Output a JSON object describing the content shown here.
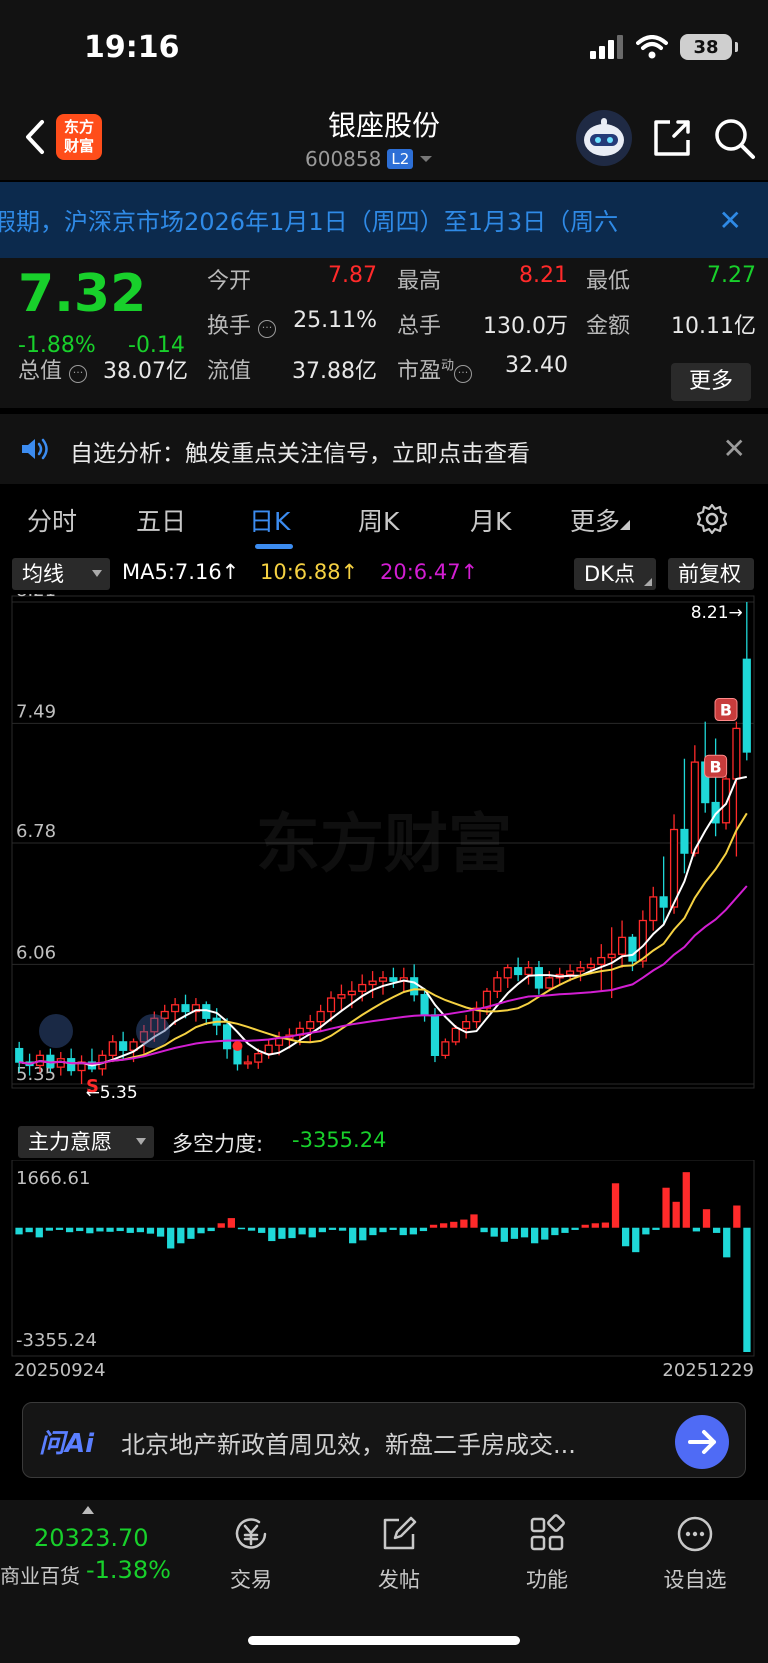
{
  "status": {
    "time": "19:16",
    "battery": "38"
  },
  "header": {
    "logo_text": "东方财富",
    "stock_name": "银座股份",
    "stock_code": "600858",
    "level_badge": "L2"
  },
  "notice": {
    "text": "假期，沪深京市场2026年1月1日（周四）至1月3日（周六"
  },
  "quote": {
    "price": "7.32",
    "change_pct": "-1.88%",
    "change_abs": "-0.14",
    "open_label": "今开",
    "open": "7.87",
    "high_label": "最高",
    "high": "8.21",
    "low_label": "最低",
    "low": "7.27",
    "turnover_label": "换手",
    "turnover": "25.11%",
    "volume_label": "总手",
    "volume": "130.0万",
    "amount_label": "金额",
    "amount": "10.11亿",
    "mktcap_label": "总值",
    "mktcap": "38.07亿",
    "float_label": "流值",
    "float_cap": "37.88亿",
    "pe_label": "市盈",
    "pe_sup": "动",
    "pe": "32.40",
    "more_label": "更多"
  },
  "alert": {
    "text": "自选分析：触发重点关注信号，立即点击查看"
  },
  "tabs": [
    "分时",
    "五日",
    "日K",
    "周K",
    "月K",
    "更多"
  ],
  "ma_bar": {
    "selector": "均线",
    "ma5": "MA5:7.16↑",
    "ma10": "10:6.88↑",
    "ma20": "20:6.47↑",
    "dk_label": "DK点",
    "adjust_label": "前复权",
    "colors": {
      "ma5": "#ffffff",
      "ma10": "#f5d142",
      "ma20": "#d21ed2",
      "up": "#ff2a2a",
      "down": "#1fd8d8"
    }
  },
  "watermark": "东方财富",
  "chart_data": [
    {
      "type": "candlestick",
      "y_ticks": [
        "8.21",
        "7.49",
        "6.78",
        "6.06",
        "5.35"
      ],
      "ylim": [
        5.35,
        8.21
      ],
      "max_label": "8.21→",
      "min_label": "←5.35",
      "signal_labels": [
        "S",
        "B",
        "B"
      ],
      "candles": [
        {
          "o": 5.56,
          "h": 5.6,
          "l": 5.42,
          "c": 5.48
        },
        {
          "o": 5.48,
          "h": 5.53,
          "l": 5.4,
          "c": 5.46
        },
        {
          "o": 5.46,
          "h": 5.55,
          "l": 5.42,
          "c": 5.52
        },
        {
          "o": 5.52,
          "h": 5.56,
          "l": 5.42,
          "c": 5.45
        },
        {
          "o": 5.45,
          "h": 5.54,
          "l": 5.4,
          "c": 5.5
        },
        {
          "o": 5.5,
          "h": 5.56,
          "l": 5.4,
          "c": 5.43
        },
        {
          "o": 5.43,
          "h": 5.52,
          "l": 5.35,
          "c": 5.48
        },
        {
          "o": 5.48,
          "h": 5.56,
          "l": 5.42,
          "c": 5.44
        },
        {
          "o": 5.44,
          "h": 5.55,
          "l": 5.4,
          "c": 5.52
        },
        {
          "o": 5.52,
          "h": 5.64,
          "l": 5.48,
          "c": 5.6
        },
        {
          "o": 5.6,
          "h": 5.66,
          "l": 5.5,
          "c": 5.55
        },
        {
          "o": 5.55,
          "h": 5.62,
          "l": 5.48,
          "c": 5.6
        },
        {
          "o": 5.6,
          "h": 5.7,
          "l": 5.52,
          "c": 5.66
        },
        {
          "o": 5.66,
          "h": 5.78,
          "l": 5.6,
          "c": 5.74
        },
        {
          "o": 5.74,
          "h": 5.82,
          "l": 5.66,
          "c": 5.78
        },
        {
          "o": 5.78,
          "h": 5.86,
          "l": 5.7,
          "c": 5.82
        },
        {
          "o": 5.82,
          "h": 5.88,
          "l": 5.74,
          "c": 5.78
        },
        {
          "o": 5.78,
          "h": 5.86,
          "l": 5.72,
          "c": 5.82
        },
        {
          "o": 5.82,
          "h": 5.84,
          "l": 5.7,
          "c": 5.74
        },
        {
          "o": 5.74,
          "h": 5.8,
          "l": 5.64,
          "c": 5.7
        },
        {
          "o": 5.7,
          "h": 5.74,
          "l": 5.5,
          "c": 5.56
        },
        {
          "o": 5.56,
          "h": 5.6,
          "l": 5.43,
          "c": 5.47
        },
        {
          "o": 5.47,
          "h": 5.52,
          "l": 5.44,
          "c": 5.48
        },
        {
          "o": 5.48,
          "h": 5.56,
          "l": 5.44,
          "c": 5.53
        },
        {
          "o": 5.53,
          "h": 5.62,
          "l": 5.5,
          "c": 5.58
        },
        {
          "o": 5.58,
          "h": 5.66,
          "l": 5.52,
          "c": 5.62
        },
        {
          "o": 5.62,
          "h": 5.68,
          "l": 5.56,
          "c": 5.64
        },
        {
          "o": 5.64,
          "h": 5.72,
          "l": 5.58,
          "c": 5.68
        },
        {
          "o": 5.68,
          "h": 5.76,
          "l": 5.6,
          "c": 5.72
        },
        {
          "o": 5.72,
          "h": 5.82,
          "l": 5.66,
          "c": 5.78
        },
        {
          "o": 5.78,
          "h": 5.9,
          "l": 5.72,
          "c": 5.86
        },
        {
          "o": 5.86,
          "h": 5.94,
          "l": 5.78,
          "c": 5.88
        },
        {
          "o": 5.88,
          "h": 5.96,
          "l": 5.8,
          "c": 5.9
        },
        {
          "o": 5.9,
          "h": 6.0,
          "l": 5.84,
          "c": 5.94
        },
        {
          "o": 5.94,
          "h": 6.02,
          "l": 5.86,
          "c": 5.96
        },
        {
          "o": 5.96,
          "h": 6.02,
          "l": 5.88,
          "c": 5.98
        },
        {
          "o": 5.98,
          "h": 6.04,
          "l": 5.92,
          "c": 5.96
        },
        {
          "o": 5.96,
          "h": 6.04,
          "l": 5.9,
          "c": 5.98
        },
        {
          "o": 5.98,
          "h": 6.06,
          "l": 5.84,
          "c": 5.88
        },
        {
          "o": 5.88,
          "h": 5.92,
          "l": 5.72,
          "c": 5.76
        },
        {
          "o": 5.76,
          "h": 5.8,
          "l": 5.48,
          "c": 5.52
        },
        {
          "o": 5.52,
          "h": 5.62,
          "l": 5.5,
          "c": 5.6
        },
        {
          "o": 5.6,
          "h": 5.7,
          "l": 5.58,
          "c": 5.68
        },
        {
          "o": 5.68,
          "h": 5.76,
          "l": 5.62,
          "c": 5.72
        },
        {
          "o": 5.72,
          "h": 5.84,
          "l": 5.68,
          "c": 5.8
        },
        {
          "o": 5.8,
          "h": 5.92,
          "l": 5.76,
          "c": 5.9
        },
        {
          "o": 5.9,
          "h": 6.02,
          "l": 5.86,
          "c": 5.98
        },
        {
          "o": 5.98,
          "h": 6.06,
          "l": 5.92,
          "c": 6.04
        },
        {
          "o": 6.04,
          "h": 6.1,
          "l": 5.96,
          "c": 6.0
        },
        {
          "o": 6.0,
          "h": 6.08,
          "l": 5.94,
          "c": 6.04
        },
        {
          "o": 6.04,
          "h": 6.08,
          "l": 5.88,
          "c": 5.92
        },
        {
          "o": 5.92,
          "h": 6.02,
          "l": 5.9,
          "c": 5.98
        },
        {
          "o": 5.98,
          "h": 6.04,
          "l": 5.94,
          "c": 6.0
        },
        {
          "o": 6.0,
          "h": 6.06,
          "l": 5.96,
          "c": 6.02
        },
        {
          "o": 6.02,
          "h": 6.08,
          "l": 5.96,
          "c": 6.04
        },
        {
          "o": 6.04,
          "h": 6.1,
          "l": 6.0,
          "c": 6.06
        },
        {
          "o": 6.06,
          "h": 6.18,
          "l": 5.9,
          "c": 6.1
        },
        {
          "o": 6.1,
          "h": 6.28,
          "l": 5.86,
          "c": 6.12
        },
        {
          "o": 6.12,
          "h": 6.32,
          "l": 6.04,
          "c": 6.22
        },
        {
          "o": 6.22,
          "h": 6.24,
          "l": 6.02,
          "c": 6.08
        },
        {
          "o": 6.08,
          "h": 6.38,
          "l": 6.04,
          "c": 6.32
        },
        {
          "o": 6.32,
          "h": 6.52,
          "l": 6.26,
          "c": 6.46
        },
        {
          "o": 6.46,
          "h": 6.7,
          "l": 6.3,
          "c": 6.4
        },
        {
          "o": 6.4,
          "h": 6.95,
          "l": 6.36,
          "c": 6.86
        },
        {
          "o": 6.86,
          "h": 7.28,
          "l": 6.6,
          "c": 6.72
        },
        {
          "o": 6.72,
          "h": 7.36,
          "l": 6.7,
          "c": 7.26
        },
        {
          "o": 7.26,
          "h": 7.5,
          "l": 6.96,
          "c": 7.02
        },
        {
          "o": 7.02,
          "h": 7.4,
          "l": 6.82,
          "c": 6.9
        },
        {
          "o": 6.9,
          "h": 7.28,
          "l": 6.86,
          "c": 7.16
        },
        {
          "o": 7.16,
          "h": 7.5,
          "l": 6.7,
          "c": 7.46
        },
        {
          "o": 7.87,
          "h": 8.21,
          "l": 7.27,
          "c": 7.32
        }
      ]
    },
    {
      "type": "bar",
      "indicator_label": "主力意愿",
      "value_label": "多空力度:",
      "value": "-3355.24",
      "y_ticks": [
        "1666.61",
        "-3355.24"
      ],
      "ylim": [
        -3355.24,
        1666.61
      ],
      "start_date": "20250924",
      "end_date": "20251229",
      "values": [
        -180,
        -120,
        -260,
        -80,
        -60,
        -120,
        -90,
        -150,
        -100,
        -110,
        -90,
        -140,
        -120,
        -160,
        -240,
        -560,
        -420,
        -300,
        -150,
        -90,
        120,
        260,
        -40,
        -80,
        -140,
        -360,
        -300,
        -280,
        -180,
        -260,
        -120,
        -60,
        -80,
        -420,
        -340,
        -200,
        -120,
        -60,
        -200,
        -180,
        -90,
        80,
        120,
        160,
        220,
        360,
        -120,
        -240,
        -380,
        -300,
        -260,
        -420,
        -320,
        -200,
        -140,
        -60,
        80,
        120,
        140,
        1200,
        -500,
        -660,
        -180,
        -60,
        1080,
        700,
        1500,
        -100,
        500,
        -140,
        -800,
        600,
        -3355.24
      ]
    }
  ],
  "ai_bar": {
    "logo": "问Ai",
    "text": "北京地产新政首周见效，新盘二手房成交..."
  },
  "bottom": {
    "index_value": "20323.70",
    "index_name": "商业百货",
    "index_change": "-1.38%",
    "nav": [
      "交易",
      "发帖",
      "功能",
      "设自选"
    ]
  }
}
